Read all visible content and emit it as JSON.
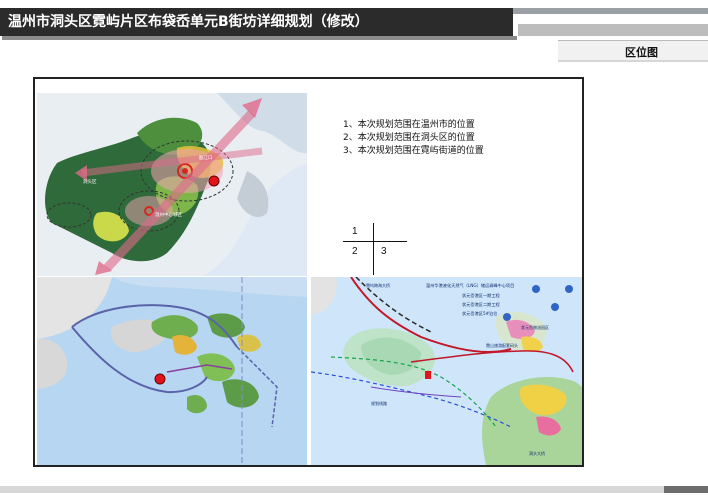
{
  "title": "温州市洞头区霓屿片区布袋岙单元B街坊详细规划（修改）",
  "section_label": "区位图",
  "notes": [
    "1、本次规划范围在温州市的位置",
    "2、本次规划范围在洞头区的位置",
    "3、本次规划范围在霓屿街道的位置"
  ],
  "grid_key": {
    "n1": "1",
    "n2": "2",
    "n3": "3"
  },
  "map1_labels": {
    "l1": "洞头区",
    "l2": "瓯江口",
    "l3": "温州中心城区"
  },
  "map3_labels": {
    "l1": "温州华港液化天然气（LNG）储运调峰中心项目",
    "l2": "状元岙港区一期工程",
    "l3": "状元岙港区二期工程",
    "l4": "状元岙港区5#泊位",
    "l5": "状元岙物流园区",
    "l6": "霓山旅游配套码头",
    "l7": "霓屿跨海大桥",
    "l8": "规划线路",
    "l9": "洞头大桥"
  },
  "colors": {
    "title_bg": "#2b2b2b",
    "marker": "#e3131b",
    "arrow": "#e06a8a",
    "sea": "#b7d6f1",
    "land_green": "#2f6b3a"
  }
}
